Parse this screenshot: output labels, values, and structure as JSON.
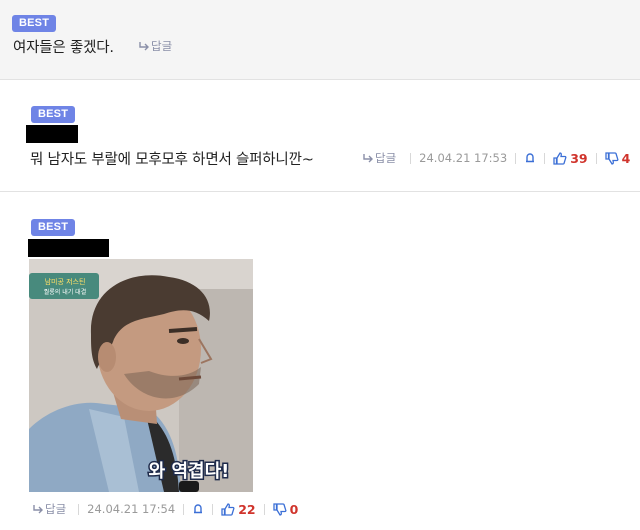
{
  "comments": [
    {
      "badge": "BEST",
      "text": "여자들은 좋겠다.",
      "reply_label": "답글"
    },
    {
      "badge": "BEST",
      "text": "뭐 남자도 부랄에 모후모후 하면서 슬퍼하니깐~",
      "reply_label": "답글",
      "date": "24.04.21 17:53",
      "likes": "39",
      "dislikes": "4"
    },
    {
      "badge": "BEST",
      "image_caption": "와 역겹다!",
      "image_badge_line1": "남미공 저스틴",
      "image_badge_line2": "퀄롱의 내기 대결",
      "reply_label": "답글",
      "date": "24.04.21 17:54",
      "likes": "22",
      "dislikes": "0"
    }
  ],
  "colors": {
    "best_badge": "#6f84e6",
    "like_icon": "#3b6fd6",
    "count": "#d0342c"
  }
}
